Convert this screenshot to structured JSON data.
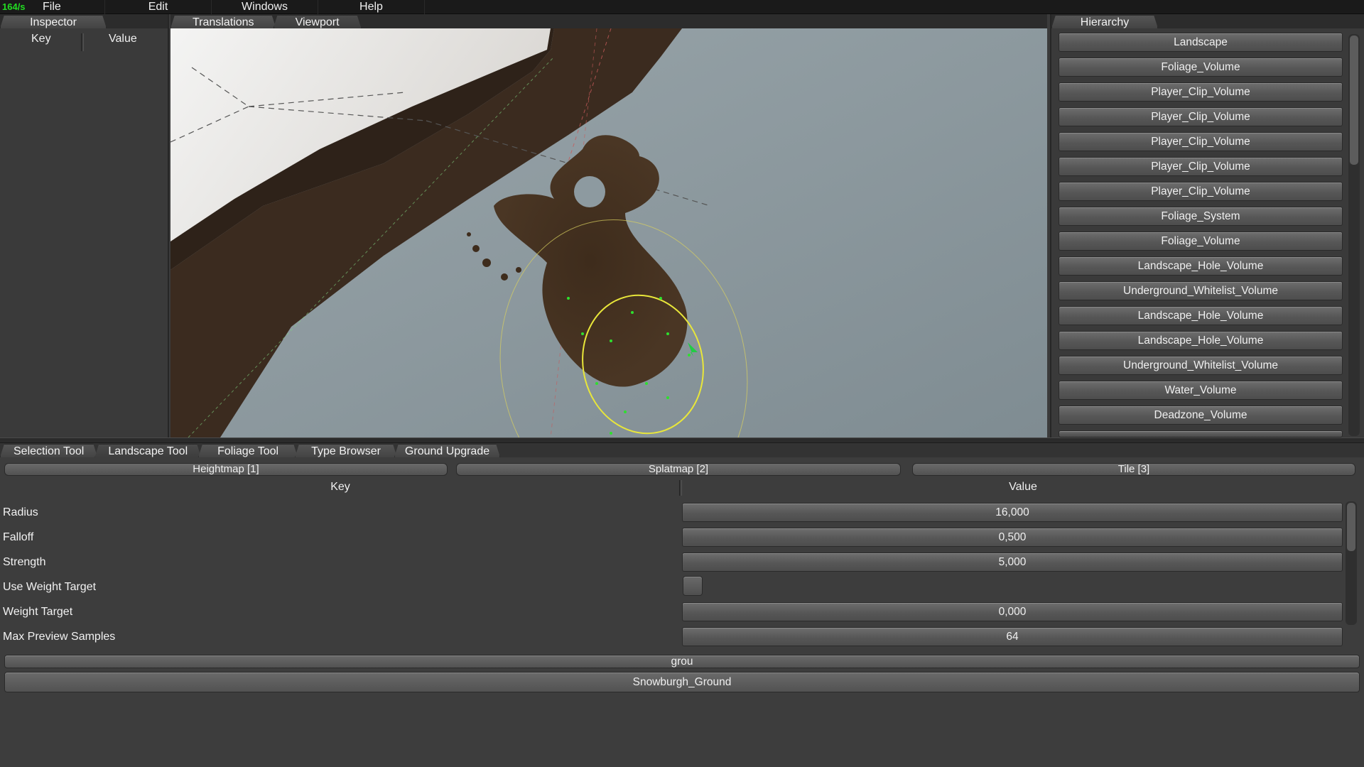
{
  "menubar": {
    "fps": "164/s",
    "items": [
      "File",
      "Edit",
      "Windows",
      "Help"
    ]
  },
  "inspector": {
    "tab": "Inspector",
    "key_header": "Key",
    "value_header": "Value"
  },
  "center_tabs": [
    "Translations",
    "Viewport"
  ],
  "hierarchy": {
    "tab": "Hierarchy",
    "items": [
      "Landscape",
      "Foliage_Volume",
      "Player_Clip_Volume",
      "Player_Clip_Volume",
      "Player_Clip_Volume",
      "Player_Clip_Volume",
      "Player_Clip_Volume",
      "Foliage_System",
      "Foliage_Volume",
      "Landscape_Hole_Volume",
      "Underground_Whitelist_Volume",
      "Landscape_Hole_Volume",
      "Landscape_Hole_Volume",
      "Underground_Whitelist_Volume",
      "Water_Volume",
      "Deadzone_Volume"
    ]
  },
  "tool_tabs": [
    "Selection Tool",
    "Landscape Tool",
    "Foliage Tool",
    "Type Browser",
    "Ground Upgrade"
  ],
  "landscape_tool": {
    "modes": [
      "Heightmap [1]",
      "Splatmap [2]",
      "Tile [3]"
    ],
    "key_header": "Key",
    "value_header": "Value",
    "properties": [
      {
        "key": "Radius",
        "value": "16,000"
      },
      {
        "key": "Falloff",
        "value": "0,500"
      },
      {
        "key": "Strength",
        "value": "5,000"
      },
      {
        "key": "Use Weight Target",
        "value": ""
      },
      {
        "key": "Weight Target",
        "value": "0,000"
      },
      {
        "key": "Max Preview Samples",
        "value": "64"
      }
    ],
    "use_weight_target_checked": false,
    "material_search": "grou",
    "material_result": "Snowburgh_Ground"
  }
}
